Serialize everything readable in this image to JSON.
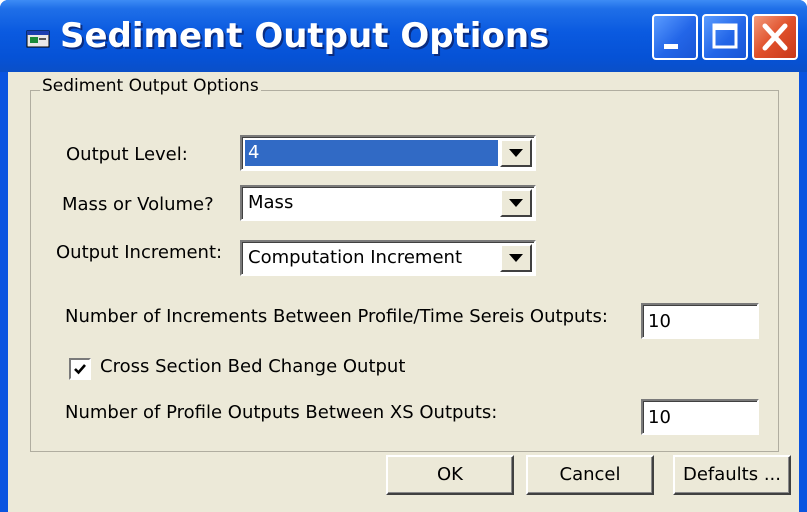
{
  "window": {
    "title": "Sediment Output Options",
    "app_icon": "window-app-icon",
    "controls": [
      "minimize-icon",
      "maximize-icon",
      "close-icon"
    ],
    "colors": {
      "titlebar": "#0a5ae0",
      "close": "#e0502a",
      "face": "#ece9d8",
      "selection": "#316ac5"
    }
  },
  "group": {
    "caption": "Sediment Output Options"
  },
  "fields": {
    "output_level": {
      "label": "Output Level:",
      "value": "4"
    },
    "mass_or_volume": {
      "label": "Mass or Volume?",
      "value": "Mass"
    },
    "output_increment": {
      "label": "Output Increment:",
      "value": "Computation Increment"
    },
    "increments_between": {
      "label": "Number of Increments Between Profile/Time Sereis Outputs:",
      "value": "10"
    },
    "cross_section": {
      "label": "Cross Section Bed Change Output",
      "checked": true
    },
    "profile_outputs": {
      "label": "Number of Profile Outputs Between XS Outputs:",
      "value": "10"
    }
  },
  "buttons": {
    "ok": "OK",
    "cancel": "Cancel",
    "defaults": "Defaults ..."
  }
}
